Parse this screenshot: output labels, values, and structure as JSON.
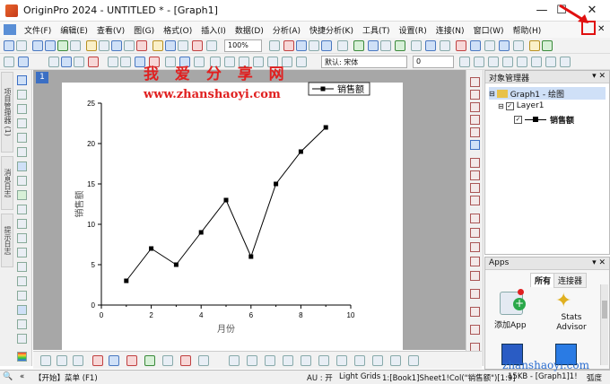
{
  "window": {
    "title": "OriginPro 2024 - UNTITLED * - [Graph1]",
    "minimize": "—",
    "maximize": "☐",
    "close": "✕"
  },
  "menu": [
    "文件(F)",
    "编辑(E)",
    "查看(V)",
    "图(G)",
    "格式(O)",
    "插入(I)",
    "数据(D)",
    "分析(A)",
    "快捷分析(K)",
    "工具(T)",
    "设置(R)",
    "连接(N)",
    "窗口(W)",
    "帮助(H)"
  ],
  "toolbar": {
    "zoom": "100%",
    "font": "默认: 宋体",
    "font_size": "0"
  },
  "left_tabs": [
    "项目管理器 (1)",
    "消息日志",
    "提示日志"
  ],
  "layer_badge": "1",
  "chart_data": {
    "type": "line",
    "x": [
      1,
      2,
      3,
      4,
      5,
      6,
      7,
      8,
      9
    ],
    "series": [
      {
        "name": "销售额",
        "values": [
          3,
          7,
          5,
          9,
          13,
          6,
          15,
          19,
          22
        ],
        "color": "#000000",
        "marker": "square"
      }
    ],
    "xlabel": "月份",
    "ylabel": "销售额",
    "xlim": [
      0,
      10
    ],
    "ylim": [
      0,
      25
    ],
    "xticks": [
      "0",
      "2",
      "4",
      "6",
      "8",
      "10"
    ],
    "yticks": [
      "0",
      "5",
      "10",
      "15",
      "20",
      "25"
    ],
    "legend": "top-right",
    "grid": false
  },
  "object_manager": {
    "title": "对象管理器",
    "graph": "Graph1 - 绘图",
    "layer": "Layer1",
    "plot": "销售额"
  },
  "apps": {
    "title": "Apps",
    "tab_all": "所有",
    "tab_connector": "连接器",
    "app1": "添加App",
    "app2": "Stats Advisor"
  },
  "status": {
    "start": "【开始】菜单 (F1)",
    "au": "AU : 开",
    "grids": "Light Grids",
    "dataset": "1:[Book1]Sheet1!Col(\"销售额\")[1:9]",
    "size": "15KB - [Graph1]1!",
    "angle": "弧度"
  },
  "watermark": {
    "line1": "我 爱 分 享 网",
    "line2": "www.zhanshaoyi.com",
    "line3": "zhanshaoyi.com"
  }
}
